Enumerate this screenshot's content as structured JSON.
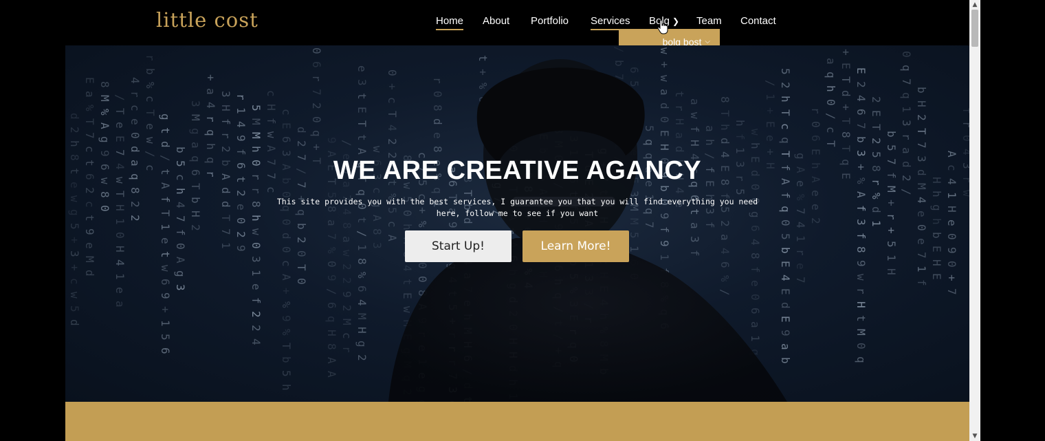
{
  "brand": {
    "logo": "little cost",
    "accent_color": "#c9a35a"
  },
  "nav": {
    "items": [
      {
        "label": "Home",
        "active": true
      },
      {
        "label": "About"
      },
      {
        "label": "Portfolio"
      },
      {
        "label": "Services",
        "underlined": true
      },
      {
        "label": "Bolg",
        "has_submenu": true
      },
      {
        "label": "Team"
      },
      {
        "label": "Contact"
      }
    ],
    "dropdown": {
      "label": "bolg bost"
    }
  },
  "hero": {
    "title": "WE ARE CREATIVE AGANCY",
    "subtitle_line1": "This site provides you with the best services, I guarantee you that you will find everything you need",
    "subtitle_line2": "here, follow me to see if you want",
    "buttons": {
      "start": "Start Up!",
      "learn": "Learn More!"
    }
  },
  "icons": [
    "chevron-right-icon",
    "chevron-down-icon",
    "hand-cursor-icon",
    "scroll-up-icon",
    "scroll-down-icon"
  ]
}
